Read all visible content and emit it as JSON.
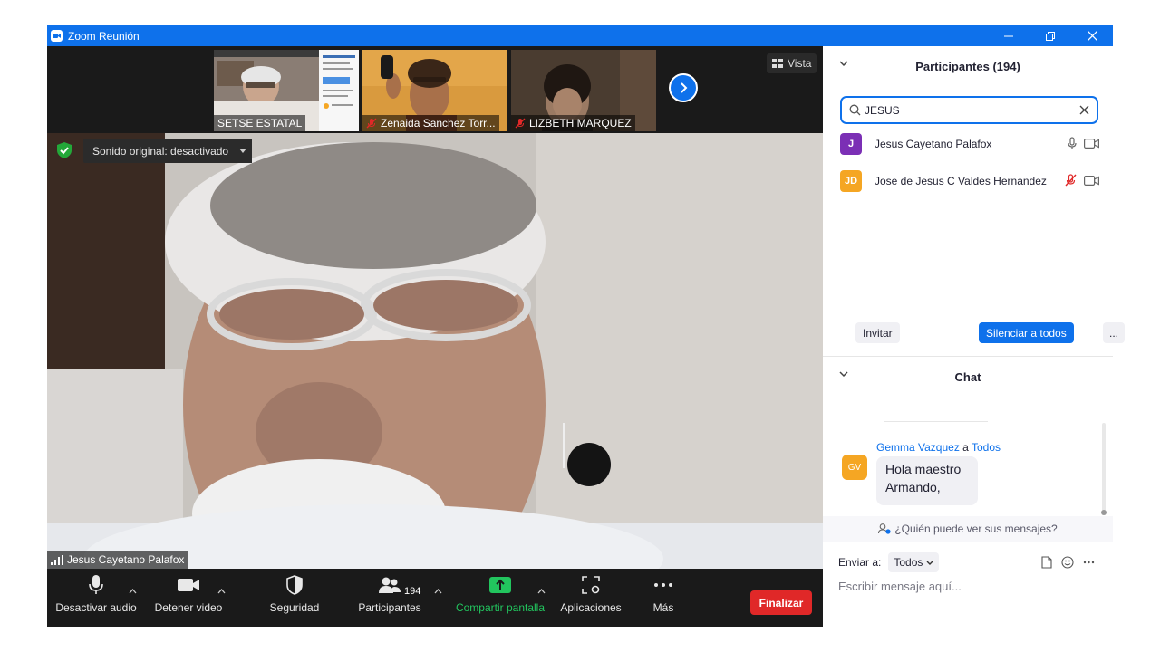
{
  "window": {
    "title": "Zoom Reunión"
  },
  "strip": {
    "thumbs": [
      {
        "name": "SETSE ESTATAL"
      },
      {
        "name": "Zenaida Sanchez Torr..."
      },
      {
        "name": "LIZBETH MARQUEZ"
      }
    ],
    "view_label": "Vista"
  },
  "main": {
    "sound_label": "Sonido original: desactivado",
    "speaker": "Jesus Cayetano Palafox"
  },
  "toolbar": {
    "mute": "Desactivar audio",
    "video": "Detener video",
    "security": "Seguridad",
    "participants": "Participantes",
    "participants_count": "194",
    "share": "Compartir pantalla",
    "apps": "Aplicaciones",
    "more": "Más",
    "end": "Finalizar"
  },
  "participants_panel": {
    "title": "Participantes (194)",
    "search_value": "JESUS",
    "rows": [
      {
        "initials": "J",
        "name": "Jesus Cayetano Palafox",
        "color": "#7b2fb5"
      },
      {
        "initials": "JD",
        "name": "Jose de Jesus C Valdes Hernandez",
        "color": "#f5a623"
      }
    ],
    "invite": "Invitar",
    "mute_all": "Silenciar a todos",
    "more": "..."
  },
  "chat": {
    "title": "Chat",
    "sender": "Gemma Vazquez",
    "sender_to_word": "a",
    "sender_to": "Todos",
    "sender_initials": "GV",
    "message_line1": "Hola maestro",
    "message_line2": "Armando,",
    "who_can_see": "¿Quién puede ver sus mensajes?",
    "send_to_label": "Enviar a:",
    "send_to_value": "Todos",
    "input_placeholder": "Escribir mensaje aquí..."
  },
  "colors": {
    "accent": "#0e71eb",
    "end": "#e02828",
    "share": "#22c55e"
  }
}
